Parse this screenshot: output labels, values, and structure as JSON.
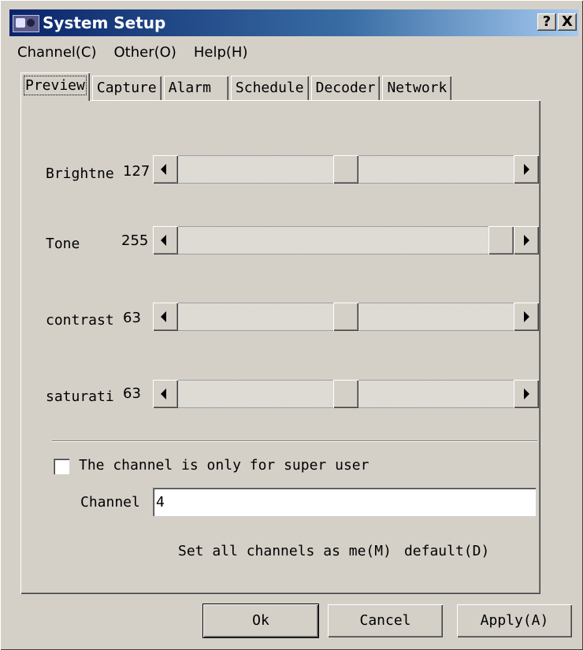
{
  "window": {
    "title": "System Setup",
    "help_button": "?",
    "close_button": "X"
  },
  "menu": [
    {
      "label": "Channel(C)"
    },
    {
      "label": "Other(O)"
    },
    {
      "label": "Help(H)"
    }
  ],
  "tabs": [
    {
      "label": "Preview",
      "active": true
    },
    {
      "label": "Capture"
    },
    {
      "label": "Alarm"
    },
    {
      "label": "Schedule"
    },
    {
      "label": "Decoder"
    },
    {
      "label": "Network"
    }
  ],
  "preview": {
    "sliders": [
      {
        "label": "Brightne",
        "value": "127",
        "fraction": 0.5
      },
      {
        "label": "Tone",
        "value": "255",
        "fraction": 1.0
      },
      {
        "label": "contrast",
        "value": "63",
        "fraction": 0.5
      },
      {
        "label": "saturati",
        "value": "63",
        "fraction": 0.5
      }
    ],
    "super_user_checkbox": {
      "label": "The channel is only for super user",
      "checked": false
    },
    "channel": {
      "label": "Channel",
      "value": "4"
    },
    "set_all_label": "Set all channels as me(M)",
    "default_label": "default(D)"
  },
  "buttons": {
    "ok": "Ok",
    "cancel": "Cancel",
    "apply": "Apply(A)"
  }
}
